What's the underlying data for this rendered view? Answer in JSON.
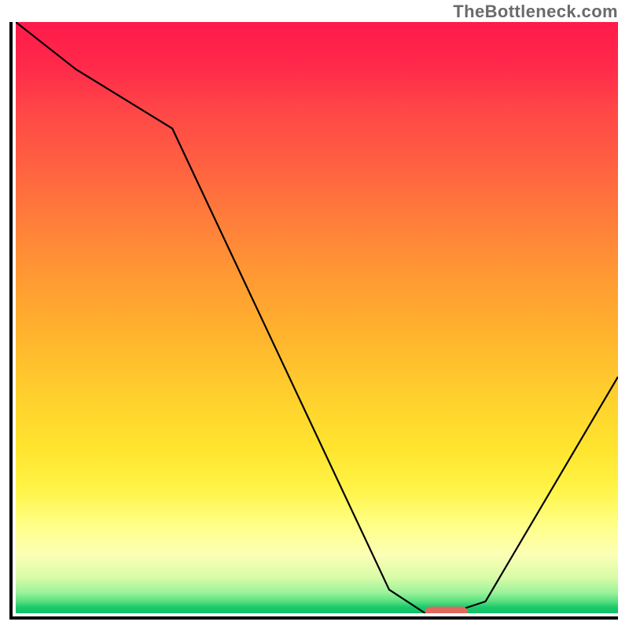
{
  "attribution": "TheBottleneck.com",
  "chart_data": {
    "type": "line",
    "title": "",
    "xlabel": "",
    "ylabel": "",
    "xlim": [
      0,
      100
    ],
    "ylim": [
      0,
      100
    ],
    "x": [
      0,
      10,
      26,
      62,
      68,
      72,
      78,
      100
    ],
    "values": [
      100,
      92,
      82,
      4,
      0,
      0,
      2,
      40
    ],
    "minimum_marker": {
      "x_start": 68,
      "x_end": 75,
      "y": 0
    },
    "background": {
      "top": "#ff1a4a",
      "mid": "#ffcf2d",
      "bottom": "#14bf66"
    }
  }
}
